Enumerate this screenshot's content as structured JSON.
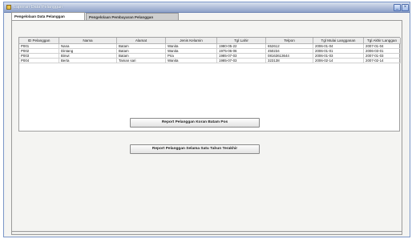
{
  "window": {
    "title": "Laporan Data Pelanggan",
    "minimize_glyph": "_",
    "close_glyph": "×"
  },
  "tabs": [
    {
      "label": "Pengelolaan Data Pelanggan",
      "active": true
    },
    {
      "label": "Pengelolaan Pembayaran Pelanggan",
      "active": false
    }
  ],
  "table": {
    "columns": [
      "ID Pelanggan",
      "Nama",
      "Alamat",
      "Jenis Kelamin",
      "Tgl Lahir",
      "Telpon",
      "Tgl Mulai Langganan",
      "Tgl Akhir Langgan"
    ],
    "rows": [
      [
        "P001",
        "Nana",
        "Batam",
        "Wanita",
        "1980-05-22",
        "652612",
        "2006-01-04",
        "2007-01-04"
      ],
      [
        "P002",
        "Dintang",
        "Batam",
        "Wanita",
        "1975-06-06",
        "450234",
        "2006-01-01",
        "2006-03-01"
      ],
      [
        "P003",
        "Binwi",
        "Batam",
        "Pria",
        "1985-07-03",
        "08163613644",
        "2006-01-03",
        "2007-01-03"
      ],
      [
        "P004",
        "Berta",
        "Taman sari",
        "Wanita",
        "1985-07-03",
        "323138",
        "2006-02-14",
        "2007-02-14"
      ]
    ]
  },
  "buttons": {
    "report_koran": "Report  Pelanggan Koran Batam Pos",
    "report_tahun": "Report Pelanggan Selama Satu Tahun Terakhir"
  }
}
